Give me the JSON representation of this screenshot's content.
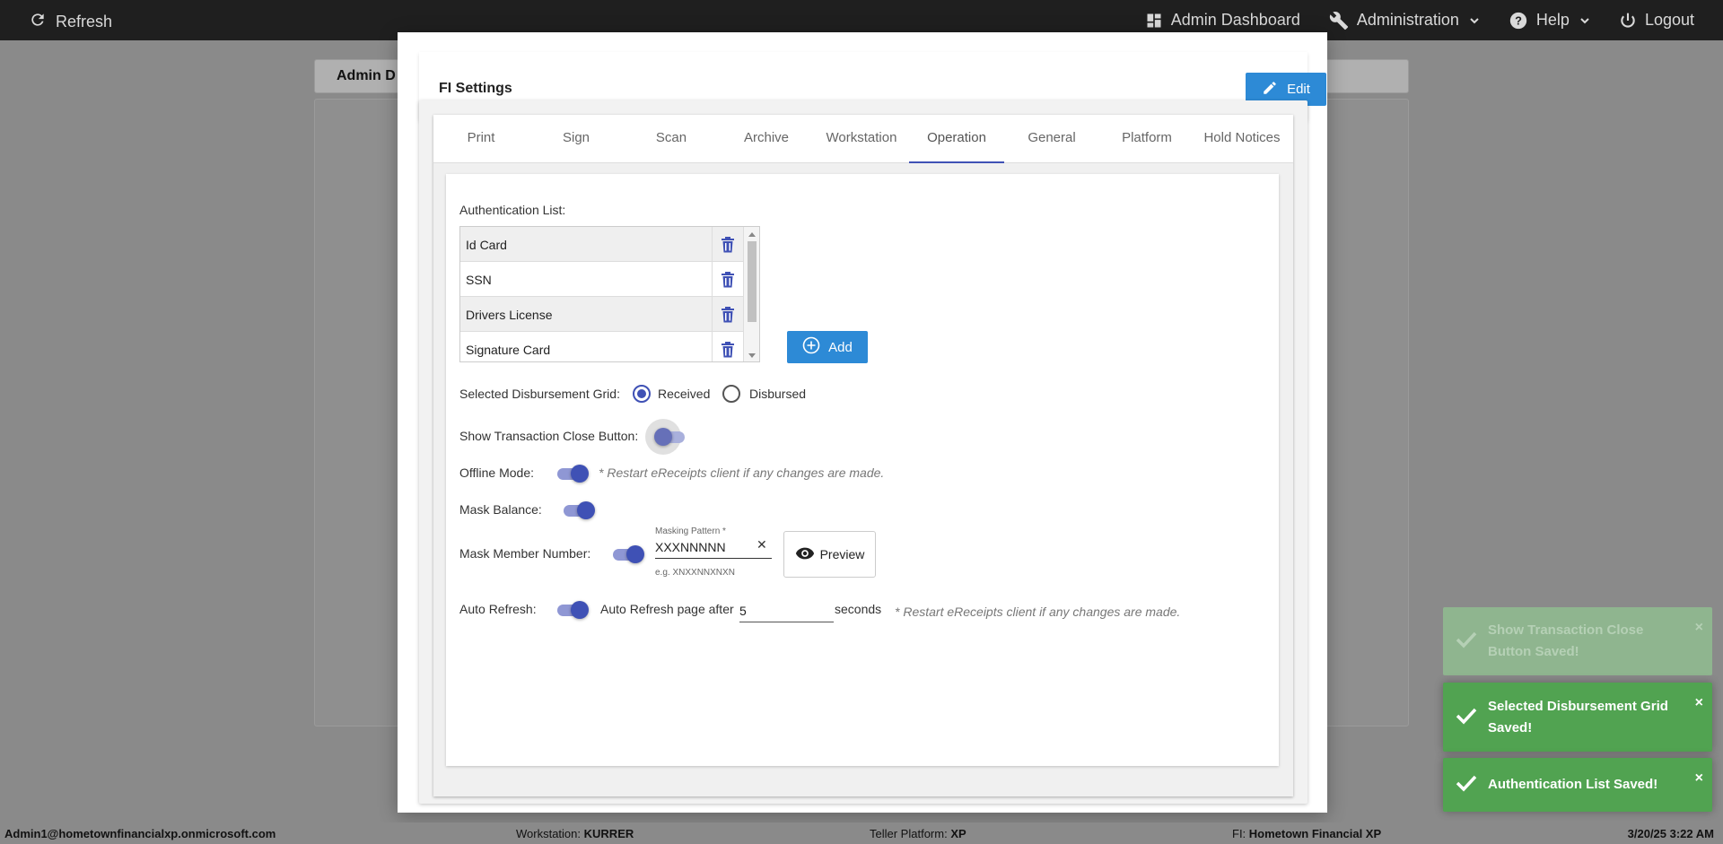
{
  "topbar": {
    "refresh_label": "Refresh",
    "admin_dashboard_label": "Admin Dashboard",
    "administration_label": "Administration",
    "help_label": "Help",
    "logout_label": "Logout"
  },
  "background": {
    "tab_label": "Admin D"
  },
  "modal": {
    "title": "FI Settings",
    "edit_label": "Edit",
    "tabs": [
      "Print",
      "Sign",
      "Scan",
      "Archive",
      "Workstation",
      "Operation",
      "General",
      "Platform",
      "Hold Notices"
    ],
    "active_tab": "Operation"
  },
  "operation": {
    "auth_list_label": "Authentication List:",
    "auth_items": [
      "Id Card",
      "SSN",
      "Drivers License",
      "Signature Card"
    ],
    "add_label": "Add",
    "disbursement_label": "Selected Disbursement Grid:",
    "received_label": "Received",
    "disbursed_label": "Disbursed",
    "selected_disbursement": "Received",
    "close_button_label": "Show Transaction Close Button:",
    "close_button_on": false,
    "offline_label": "Offline Mode:",
    "offline_on": true,
    "restart_note": "* Restart eReceipts client if any changes are made.",
    "mask_balance_label": "Mask Balance:",
    "mask_balance_on": true,
    "mask_member_label": "Mask Member Number:",
    "mask_member_on": true,
    "masking_pattern_label": "Masking Pattern *",
    "masking_pattern_value": "XXXNNNNN",
    "masking_pattern_hint": "e.g. XNXXNNXNXN",
    "clear_symbol": "✕",
    "preview_label": "Preview",
    "auto_refresh_label": "Auto Refresh:",
    "auto_refresh_on": true,
    "auto_refresh_text": "Auto Refresh page after",
    "auto_refresh_value": "5",
    "seconds_label": "seconds",
    "restart_note_2": "* Restart eReceipts client if any changes are made."
  },
  "toasts": [
    {
      "message": "Show Transaction Close Button Saved!",
      "faded": true
    },
    {
      "message": "Selected Disbursement Grid Saved!",
      "faded": false
    },
    {
      "message": "Authentication List Saved!",
      "faded": false
    }
  ],
  "toast_close_symbol": "×",
  "statusbar": {
    "user": "Admin1@hometownfinancialxp.onmicrosoft.com",
    "workstation_label": "Workstation:",
    "workstation_value": "KURRER",
    "platform_label": "Teller Platform:",
    "platform_value": "XP",
    "fi_label": "FI:",
    "fi_value": "Hometown Financial XP",
    "datetime": "3/20/25 3:22 AM"
  },
  "colors": {
    "accent": "#3f51b5",
    "button_blue": "#2d8ad6",
    "toast_green": "#51a351",
    "topbar": "#1f1f1f"
  }
}
